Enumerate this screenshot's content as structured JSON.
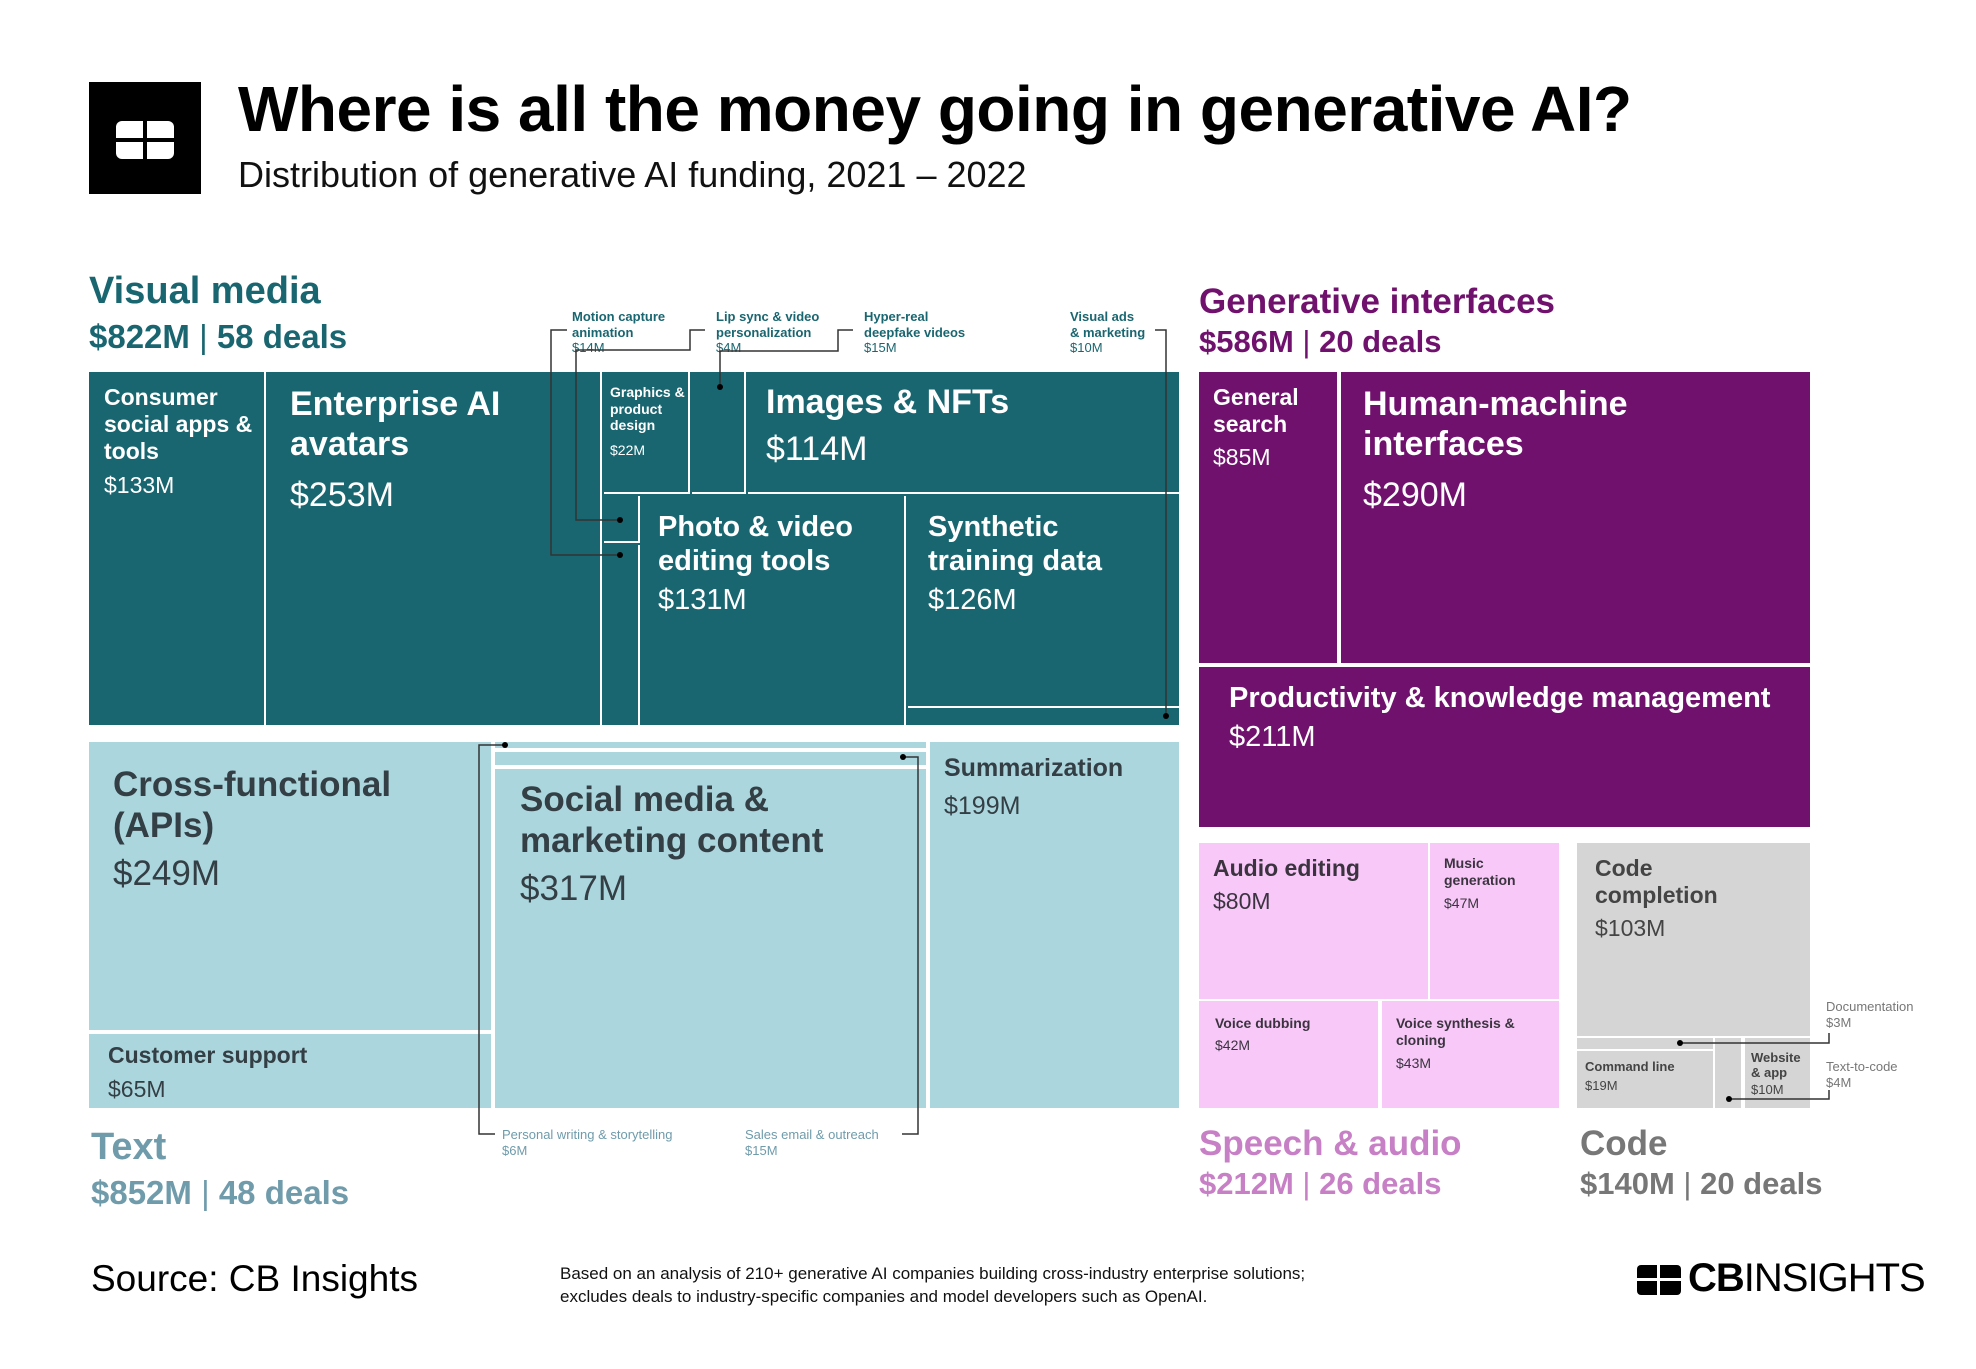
{
  "header": {
    "title": "Where is all the money going in generative AI?",
    "subtitle": "Distribution of generative AI funding, 2021 – 2022",
    "logo_icon": "cb-insights-logo-icon"
  },
  "colors": {
    "visual_media": "#1a6670",
    "text": "#acd6de",
    "text_label": "#6f9bab",
    "generative_interfaces": "#70126d",
    "speech_audio": "#f8c9f8",
    "speech_audio_label": "#c77fc5",
    "code": "#d6d5d6",
    "code_label": "#777777"
  },
  "chart_data": {
    "type": "treemap",
    "title": "Where is all the money going in generative AI?",
    "subtitle": "Distribution of generative AI funding, 2021 – 2022",
    "unit": "USD millions",
    "groups": [
      {
        "name": "Visual media",
        "total": "$822M",
        "deals": "58 deals",
        "total_value": 822,
        "deal_count": 58,
        "segments": [
          {
            "name": "Consumer social apps & tools",
            "label": "$133M",
            "value": 133
          },
          {
            "name": "Enterprise AI avatars",
            "label": "$253M",
            "value": 253
          },
          {
            "name": "Graphics & product design",
            "label": "$22M",
            "value": 22
          },
          {
            "name": "Images & NFTs",
            "label": "$114M",
            "value": 114
          },
          {
            "name": "Photo & video editing tools",
            "label": "$131M",
            "value": 131
          },
          {
            "name": "Synthetic training data",
            "label": "$126M",
            "value": 126
          },
          {
            "name": "Motion capture animation",
            "label": "$14M",
            "value": 14
          },
          {
            "name": "Lip sync & video personalization",
            "label": "$4M",
            "value": 4
          },
          {
            "name": "Hyper-real deepfake videos",
            "label": "$15M",
            "value": 15
          },
          {
            "name": "Visual ads & marketing",
            "label": "$10M",
            "value": 10
          }
        ]
      },
      {
        "name": "Text",
        "total": "$852M",
        "deals": "48 deals",
        "total_value": 852,
        "deal_count": 48,
        "segments": [
          {
            "name": "Cross-functional (APIs)",
            "label": "$249M",
            "value": 249
          },
          {
            "name": "Customer support",
            "label": "$65M",
            "value": 65
          },
          {
            "name": "Social media & marketing content",
            "label": "$317M",
            "value": 317
          },
          {
            "name": "Summarization",
            "label": "$199M",
            "value": 199
          },
          {
            "name": "Personal writing & storytelling",
            "label": "$6M",
            "value": 6
          },
          {
            "name": "Sales email & outreach",
            "label": "$15M",
            "value": 15
          }
        ]
      },
      {
        "name": "Generative interfaces",
        "total": "$586M",
        "deals": "20 deals",
        "total_value": 586,
        "deal_count": 20,
        "segments": [
          {
            "name": "General search",
            "label": "$85M",
            "value": 85
          },
          {
            "name": "Human-machine interfaces",
            "label": "$290M",
            "value": 290
          },
          {
            "name": "Productivity & knowledge management",
            "label": "$211M",
            "value": 211
          }
        ]
      },
      {
        "name": "Speech & audio",
        "total": "$212M",
        "deals": "26 deals",
        "total_value": 212,
        "deal_count": 26,
        "segments": [
          {
            "name": "Audio editing",
            "label": "$80M",
            "value": 80
          },
          {
            "name": "Music generation",
            "label": "$47M",
            "value": 47
          },
          {
            "name": "Voice dubbing",
            "label": "$42M",
            "value": 42
          },
          {
            "name": "Voice synthesis & cloning",
            "label": "$43M",
            "value": 43
          }
        ]
      },
      {
        "name": "Code",
        "total": "$140M",
        "deals": "20 deals",
        "total_value": 140,
        "deal_count": 20,
        "segments": [
          {
            "name": "Code completion",
            "label": "$103M",
            "value": 103
          },
          {
            "name": "Command line",
            "label": "$19M",
            "value": 19
          },
          {
            "name": "Website & app",
            "label": "$10M",
            "value": 10
          },
          {
            "name": "Documentation",
            "label": "$3M",
            "value": 3
          },
          {
            "name": "Text-to-code",
            "label": "$4M",
            "value": 4
          }
        ]
      }
    ]
  },
  "labels": {
    "vm": {
      "consumer": [
        "Consumer",
        "social apps &",
        "tools"
      ],
      "enterprise": [
        "Enterprise AI",
        "avatars"
      ],
      "graphics": [
        "Graphics &",
        "product",
        "design"
      ],
      "images": "Images & NFTs",
      "photo": [
        "Photo & video",
        "editing tools"
      ],
      "synthetic": [
        "Synthetic",
        "training data"
      ],
      "motion": [
        "Motion capture",
        "animation"
      ],
      "lipsync": [
        "Lip sync & video",
        "personalization"
      ],
      "deepfake": [
        "Hyper-real",
        "deepfake videos"
      ],
      "visualads": [
        "Visual ads",
        "& marketing"
      ]
    },
    "tx": {
      "cross": [
        "Cross-functional",
        "(APIs)"
      ],
      "support": "Customer support",
      "social": [
        "Social media &",
        "marketing content"
      ],
      "summ": "Summarization",
      "personal": "Personal writing & storytelling",
      "sales": "Sales email & outreach"
    },
    "gi": {
      "search": [
        "General",
        "search"
      ],
      "hmi": [
        "Human-machine",
        "interfaces"
      ],
      "prod": "Productivity & knowledge management"
    },
    "sa": {
      "audio": "Audio editing",
      "music": [
        "Music",
        "generation"
      ],
      "dubbing": "Voice dubbing",
      "synth": [
        "Voice synthesis &",
        "cloning"
      ]
    },
    "cd": {
      "completion": [
        "Code",
        "completion"
      ],
      "cmd": "Command line",
      "web": [
        "Website",
        "& app"
      ],
      "doc": "Documentation",
      "t2c": "Text-to-code"
    }
  },
  "footer": {
    "source": "Source: CB Insights",
    "note_line1": "Based on an analysis of 210+ generative AI companies building cross-industry enterprise solutions;",
    "note_line2": "excludes deals to industry-specific companies and model developers such as OpenAI.",
    "brand": "CBINSIGHTS"
  }
}
